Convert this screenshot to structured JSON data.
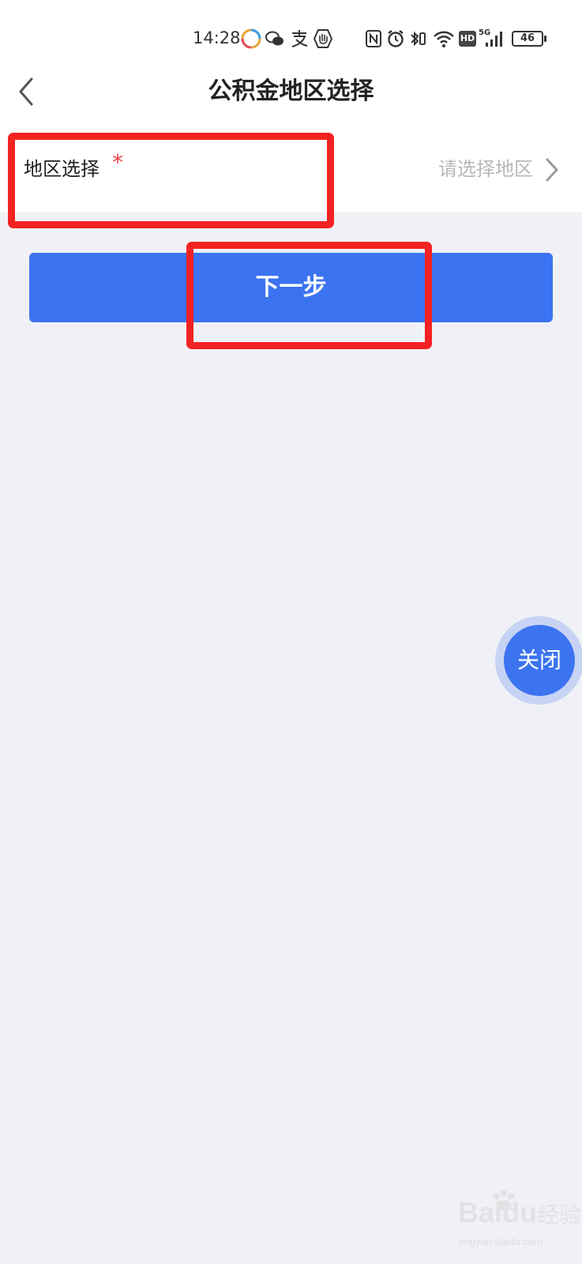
{
  "status_bar": {
    "time": "14:28",
    "battery": "46",
    "network": "5G",
    "hd_badge": "HD",
    "left_icons": [
      "app-icon",
      "wechat-icon",
      "alipay-icon",
      "hand-icon"
    ],
    "right_icons": [
      "nfc-icon",
      "alarm-icon",
      "vibrate-icon",
      "wifi-icon",
      "hd-icon",
      "signal-icon",
      "battery-icon"
    ]
  },
  "nav": {
    "title": "公积金地区选择",
    "back_icon": "chevron-left-icon"
  },
  "form": {
    "region_label": "地区选择",
    "required_mark": "*",
    "region_placeholder": "请选择地区",
    "chevron_icon": "chevron-right-icon"
  },
  "actions": {
    "next_label": "下一步"
  },
  "floating": {
    "close_label": "关闭"
  },
  "watermark": {
    "brand": "Bai",
    "brand_suffix": "du",
    "brand_cn": "经验",
    "url": "jingyan.baidu.com"
  },
  "colors": {
    "accent": "#3c73f0",
    "annotation": "#f52222",
    "page_bg": "#f0f1f6",
    "required": "#f04040",
    "placeholder": "#b8b8b8"
  }
}
